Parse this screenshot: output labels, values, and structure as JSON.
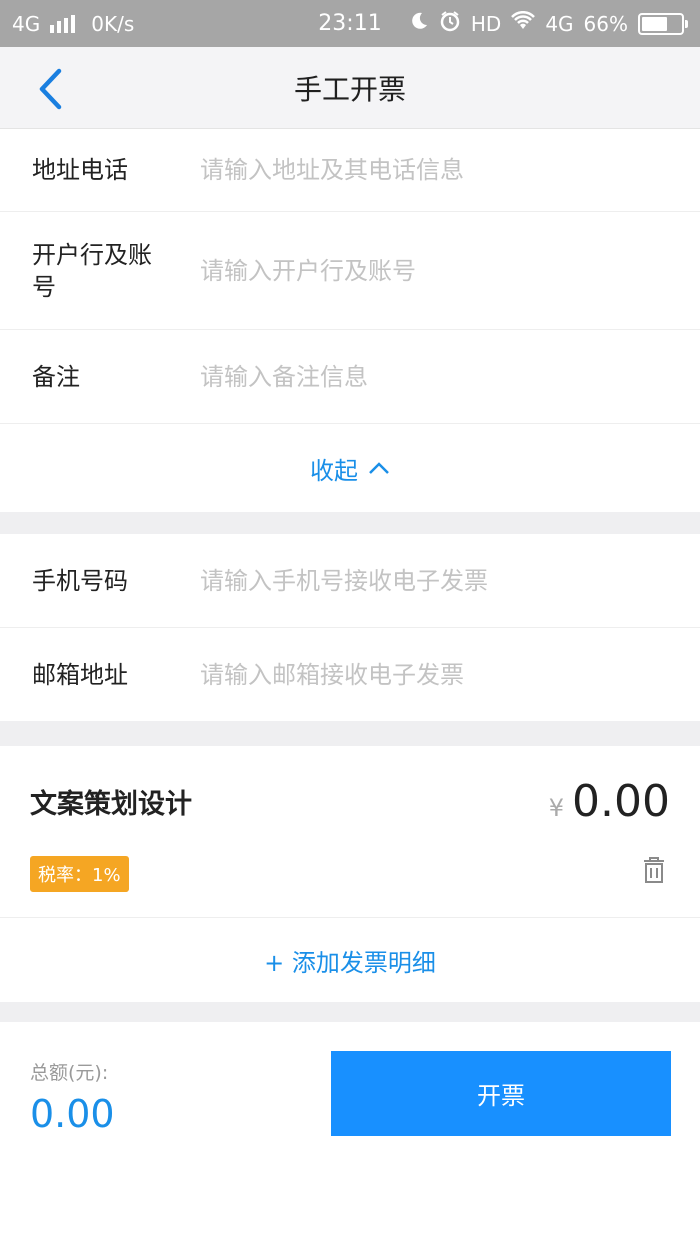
{
  "status_bar": {
    "network": "4G",
    "speed": "0K/s",
    "time": "23:11",
    "hd": "HD",
    "network2": "4G",
    "battery": "66%",
    "battery_level": 0.66,
    "icons": [
      "signal-bars-icon",
      "moon-icon",
      "alarm-icon",
      "wifi-icon",
      "battery-icon"
    ]
  },
  "nav": {
    "title": "手工开票",
    "back_icon": "chevron-left-icon"
  },
  "form": {
    "address": {
      "label": "地址电话",
      "placeholder": "请输入地址及其电话信息"
    },
    "bank": {
      "label_line1": "开户行及账",
      "label_line2": "号",
      "placeholder": "请输入开户行及账号"
    },
    "remark": {
      "label": "备注",
      "placeholder": "请输入备注信息"
    },
    "collapse": "收起"
  },
  "contact": {
    "phone": {
      "label": "手机号码",
      "placeholder": "请输入手机号接收电子发票"
    },
    "email": {
      "label": "邮箱地址",
      "placeholder": "请输入邮箱接收电子发票"
    }
  },
  "item": {
    "name": "文案策划设计",
    "currency": "¥",
    "amount": "0.00",
    "tax_rate": "税率：1%"
  },
  "add_detail": "+ 添加发票明细",
  "footer": {
    "total_label": "总额(元):",
    "total_value": "0.00",
    "issue_label": "开票"
  },
  "colors": {
    "accent": "#1890ff",
    "link": "#1a8fe8",
    "badge": "#f5a623"
  }
}
